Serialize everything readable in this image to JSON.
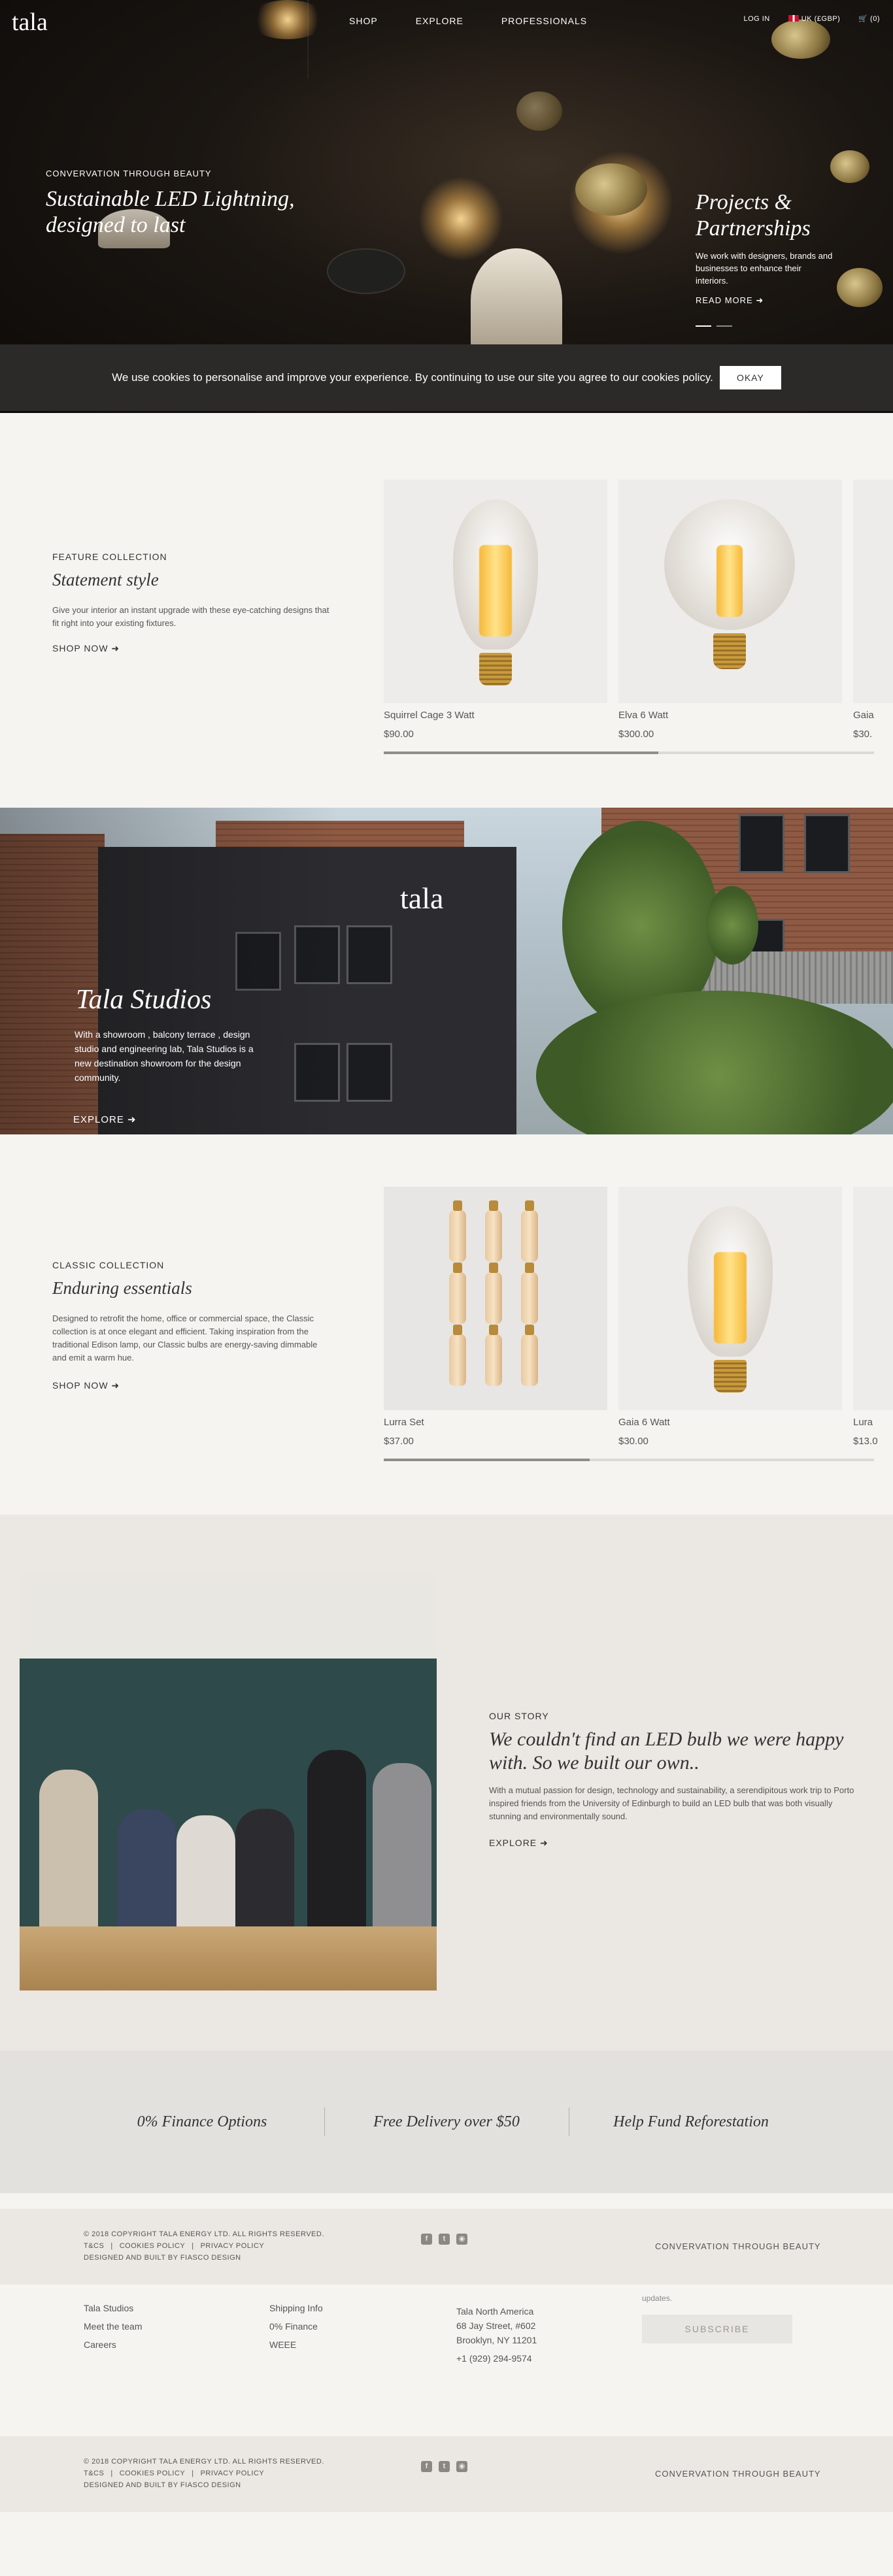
{
  "header": {
    "logo": "tala",
    "nav": [
      "SHOP",
      "EXPLORE",
      "PROFESSIONALS"
    ],
    "login": "LOG IN",
    "currency": "UK (£GBP)",
    "cart_count": "(0)"
  },
  "hero": {
    "eyebrow": "CONVERVATION THROUGH BEAUTY",
    "title": "Sustainable LED Lightning, designed to last",
    "side_title": "Projects & Partnerships",
    "side_text": "We work with designers, brands and businesses to enhance their interiors.",
    "side_link": "READ MORE"
  },
  "cookie": {
    "message": "We use cookies to personalise and improve your experience. By continuing to use our site you agree to our cookies policy.",
    "button": "OKAY"
  },
  "feature": {
    "eyebrow": "FEATURE COLLECTION",
    "title": "Statement style",
    "text": "Give your interior an instant upgrade with these eye-catching designs that fit right into your existing fixtures.",
    "link": "SHOP NOW",
    "products": [
      {
        "name": "Squirrel Cage 3 Watt",
        "price": "$90.00"
      },
      {
        "name": "Elva 6 Watt",
        "price": "$300.00"
      },
      {
        "name": "Gaia",
        "price": "$30."
      }
    ],
    "slider_progress": 0.56
  },
  "studios": {
    "logo": "tala",
    "title": "Tala Studios",
    "text": "With a showroom , balcony terrace , design studio and engineering lab, Tala Studios is a new destination showroom for the design community.",
    "link": "EXPLORE"
  },
  "classic": {
    "eyebrow": "CLASSIC COLLECTION",
    "title": "Enduring essentials",
    "text": "Designed to retrofit the home, office or commercial space, the Classic collection is at once elegant and efficient. Taking inspiration from the traditional Edison lamp, our Classic bulbs are energy-saving dimmable and emit a warm hue.",
    "link": "SHOP NOW",
    "products": [
      {
        "name": "Lurra Set",
        "price": "$37.00"
      },
      {
        "name": "Gaia 6 Watt",
        "price": "$30.00"
      },
      {
        "name": "Lura",
        "price": "$13.0"
      }
    ],
    "slider_progress": 0.42
  },
  "story": {
    "eyebrow": "OUR STORY",
    "title": "We couldn't find an LED bulb we were happy with. So we built our own..",
    "text": "With a mutual passion for design, technology and sustainability, a serendipitous work trip to Porto inspired friends from the University of Edinburgh to build an LED bulb that was both visually stunning and environmentally sound.",
    "link": "EXPLORE"
  },
  "benefits": [
    "0% Finance Options",
    "Free Delivery over $50",
    "Help Fund Reforestation"
  ],
  "footer": {
    "copyright": "© 2018 COPYRIGHT TALA ENERGY LTD. ALL RIGHTS RESERVED.",
    "legal_links": [
      "T&CS",
      "COOKIES POLICY",
      "PRIVACY POLICY"
    ],
    "credit": "DESIGNED AND BUILT BY FIASCO DESIGN",
    "tagline": "CONVERVATION THROUGH BEAUTY",
    "col1": [
      "Tala Studios",
      "Meet the team",
      "Careers"
    ],
    "col2": [
      "Shipping Info",
      "0% Finance",
      "WEEE"
    ],
    "address": [
      "Tala North America",
      "68 Jay Street, #602",
      "Brooklyn, NY 11201",
      "+1 (929) 294-9574"
    ],
    "updates": "updates.",
    "subscribe": "SUBSCRIBE"
  }
}
